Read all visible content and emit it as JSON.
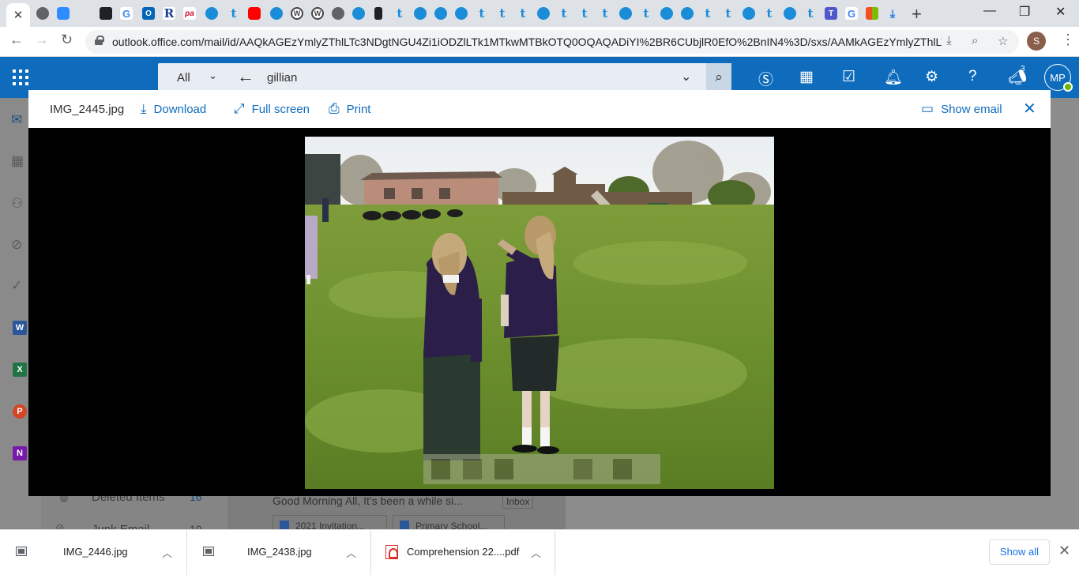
{
  "browser": {
    "active_tab_close": "✕",
    "new_tab": "+",
    "url": "outlook.office.com/mail/id/AAQkAGEzYmlyZThlLTc3NDgtNGU4Zi1iODZlLTk1MTkwMTBkOTQ0OQAQADiYI%2BR6CUbjlR0EfO%2BnIN4%3D/sxs/AAMkAGEzYmlyZThlLTc3...",
    "profile_initial": "S"
  },
  "outlook": {
    "search_scope": "All",
    "search_query": "gillian",
    "notification_count": "3",
    "user_initials": "MP"
  },
  "viewer": {
    "filename": "IMG_2445.jpg",
    "download_label": "Download",
    "fullscreen_label": "Full screen",
    "print_label": "Print",
    "show_email_label": "Show email"
  },
  "background": {
    "folder_deleted": "Deleted Items",
    "folder_deleted_count": "16",
    "folder_junk": "Junk Email",
    "folder_junk_count": "10",
    "message_preview": "Good Morning All, It's been a while si...",
    "inbox_tag": "Inbox",
    "attachment1": "2021 Invitation...",
    "attachment2": "Primary School..."
  },
  "downloads": {
    "items": [
      {
        "name": "IMG_2446.jpg"
      },
      {
        "name": "IMG_2438.jpg"
      },
      {
        "name": "Comprehension 22....pdf"
      }
    ],
    "show_all_label": "Show all"
  },
  "colors": {
    "outlook_blue": "#0f6cbd",
    "chrome_tabstrip": "#dee1e6",
    "overlay_black": "#000000"
  }
}
